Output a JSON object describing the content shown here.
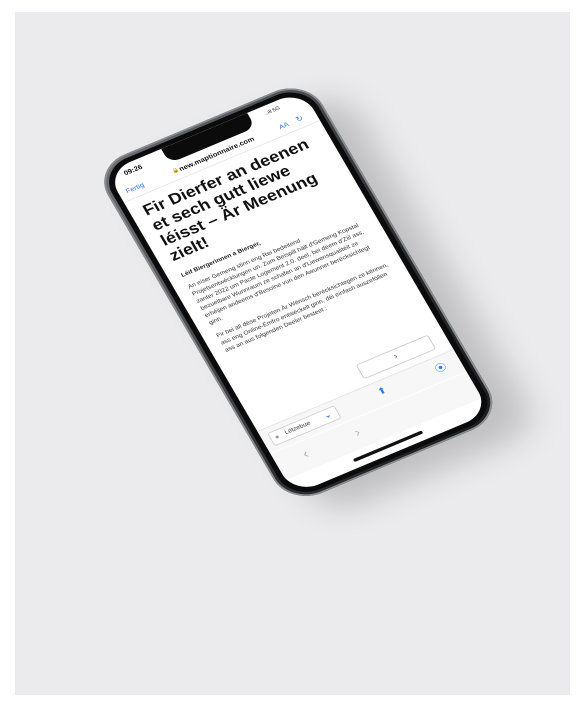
{
  "status_bar": {
    "time": "09:26",
    "signal": "..ıll 5G"
  },
  "browser": {
    "done_label": "Fertig",
    "url": "new.maptionnaire.com",
    "text_size_label": "AA"
  },
  "page": {
    "heading": "Fir Dierfer an deenen et sech gutt liewe léisst – Är Meenung zielt!",
    "greeting": "Léif Biergerinnen a Bierger,",
    "paragraph_1": "An eiser Gemeng stinn eng Rei bedeitend Projetsentwécklungen un. Zum Beispill hält d'Gemeng Kopstal zanter 2022 um Pacte Logement 2.0. deel, bei deem d'Ziil ass, bezuelbare Wunnraum ze schafen an d'Liewensqualitéit ze erhéijen andeems d'Besoine vun den Awunner berécksichtegt ginn.",
    "paragraph_2": "Fir bei all dëse Projeten Är Wënsch berécksichtegen ze kënnen, ass eng Online-Ëmfro entwéckelt ginn, déi einfach auszeföllen ass an aus folgenden Deeler besteet :",
    "next_label": "›"
  },
  "footer": {
    "language": "Lëtzebue"
  },
  "icons": {
    "lock": "lock-icon",
    "reload": "reload-icon",
    "globe": "globe-icon",
    "chevron": "chevron-down-icon",
    "share": "share-icon",
    "compass": "compass-icon",
    "back": "back-icon",
    "forward": "forward-icon"
  },
  "colors": {
    "accent": "#2f7cf6",
    "select_chevron": "#2b59d9",
    "backdrop": "#ebebed"
  }
}
